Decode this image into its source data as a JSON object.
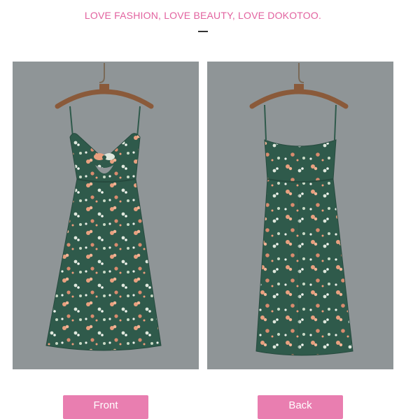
{
  "header": {
    "tagline": "LOVE FASHION, LOVE BEAUTY, LOVE DOKOTOO."
  },
  "views": [
    {
      "id": "front",
      "label": "Front"
    },
    {
      "id": "back",
      "label": "Back"
    }
  ],
  "colors": {
    "tagline": "#e2629f",
    "button": "#e97eb0",
    "photo_background": "#8f9597",
    "dress": "#2f5a4b"
  }
}
